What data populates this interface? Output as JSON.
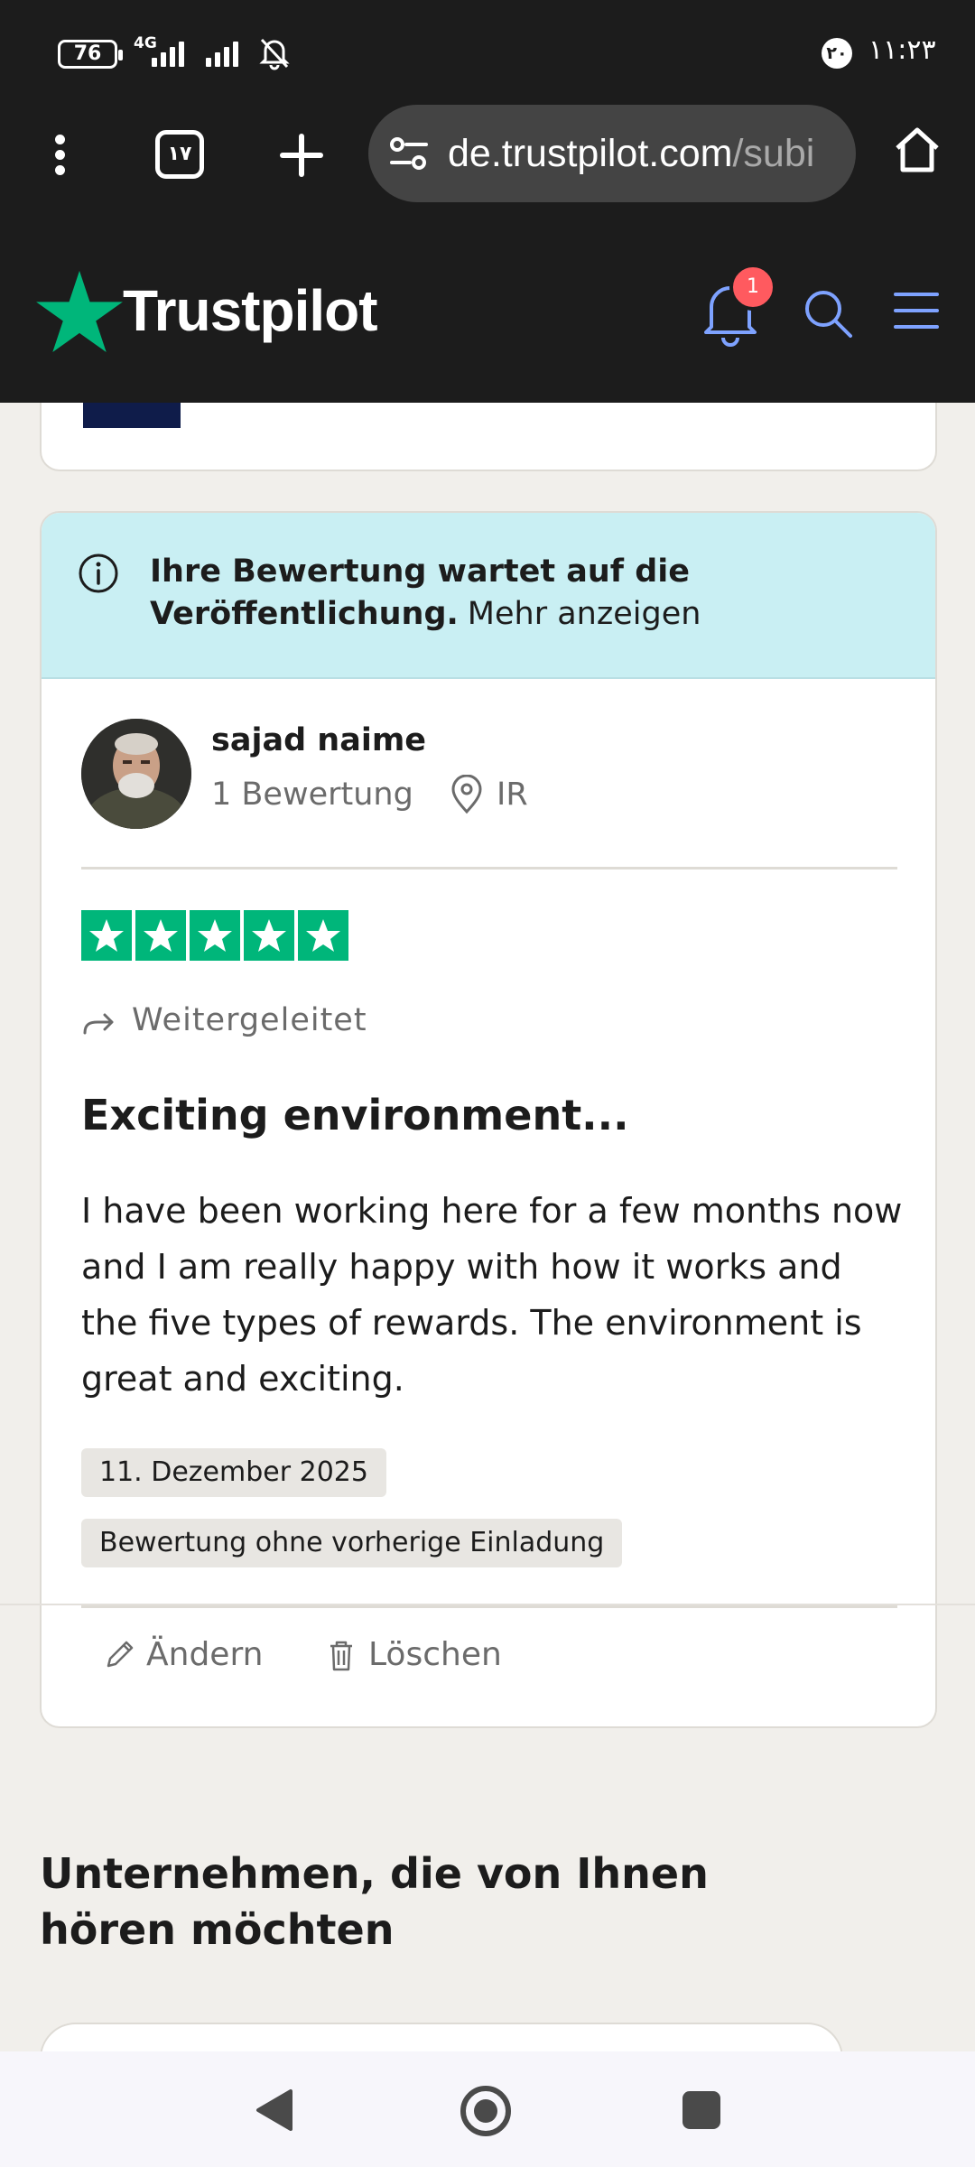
{
  "status_bar": {
    "battery": "76",
    "network": "4G",
    "sim_badge": "۲۰",
    "time": "۱۱:۲۳"
  },
  "browser": {
    "tab_count": "۱۷",
    "url_main": "de.trustpilot.com",
    "url_rest": "/subi"
  },
  "header": {
    "logo_text": "Trustpilot",
    "notification_count": "1",
    "brand_color": "#00b67a",
    "accent_color": "#7ea2ff"
  },
  "review_card": {
    "pending_bold": "Ihre Bewertung wartet auf die Veröffentlichung.",
    "pending_link": "Mehr anzeigen",
    "reviewer_name": "sajad naime",
    "review_count": "1 Bewertung",
    "country": "IR",
    "rating": 5,
    "forwarded_label": "Weitergeleitet",
    "title": "Exciting environment...",
    "body": "I have been working here for a few months now and I am really happy with how it works and the five types of rewards. The environment is great and exciting.",
    "date_tag": "11. Dezember 2025",
    "source_tag": "Bewertung ohne vorherige Einladung",
    "edit_label": "Ändern",
    "delete_label": "Löschen"
  },
  "companies_section": {
    "heading": "Unternehmen, die von Ihnen hören möchten"
  }
}
